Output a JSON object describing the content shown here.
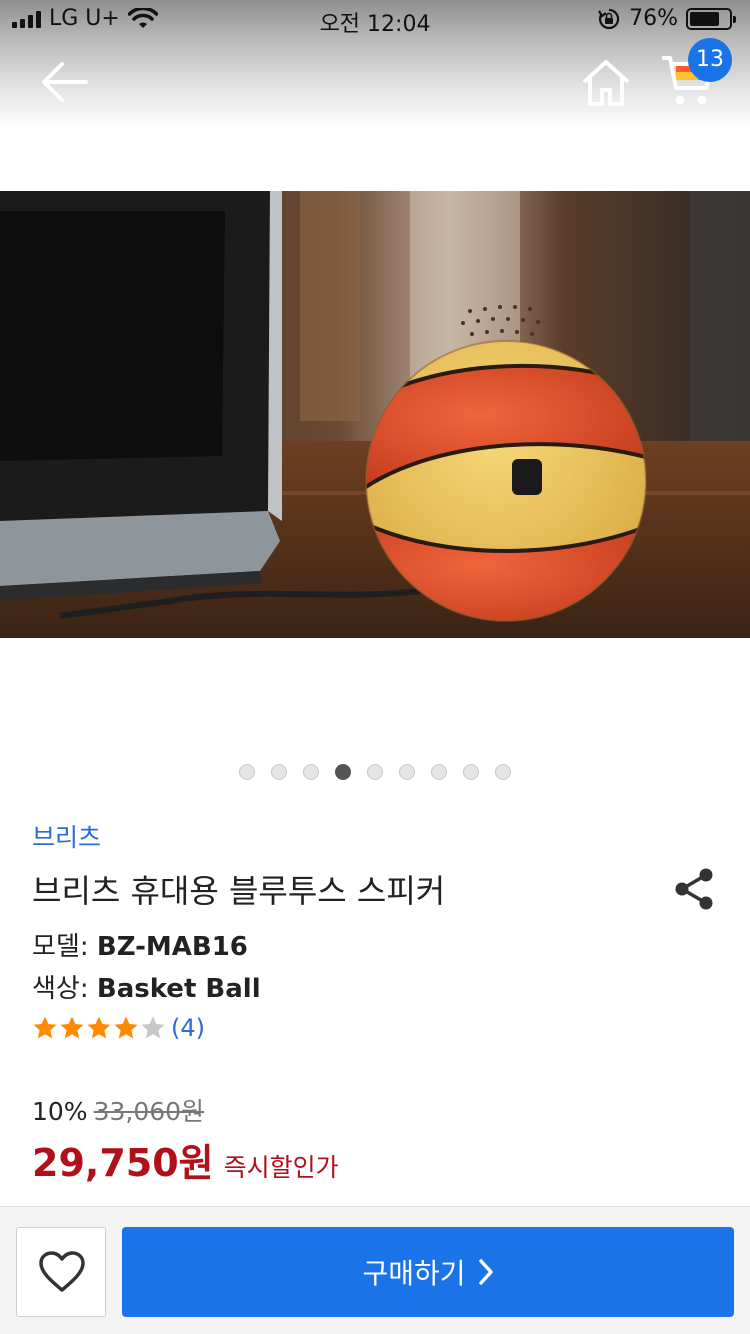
{
  "status_bar": {
    "carrier": "LG U+",
    "time": "오전 12:04",
    "battery": "76%",
    "battery_level": 0.76
  },
  "header": {
    "cart_count": "13"
  },
  "gallery": {
    "total_images": 9,
    "active_index": 3
  },
  "product": {
    "brand": "브리츠",
    "title": "브리츠 휴대용 블루투스 스피커",
    "model_label": "모델:",
    "model_value": "BZ-MAB16",
    "color_label": "색상:",
    "color_value": "Basket Ball",
    "rating_stars": 4,
    "rating_max": 5,
    "review_count": "(4)"
  },
  "pricing": {
    "discount_rate": "10%",
    "original_price": "33,060원",
    "sale_price": "29,750원",
    "sale_note": "즉시할인가"
  },
  "footer": {
    "buy_label": "구매하기"
  },
  "colors": {
    "accent_blue": "#1a73e8",
    "price_red": "#b1101a",
    "link_blue": "#2c6ad9",
    "star_orange": "#ff8a00"
  }
}
